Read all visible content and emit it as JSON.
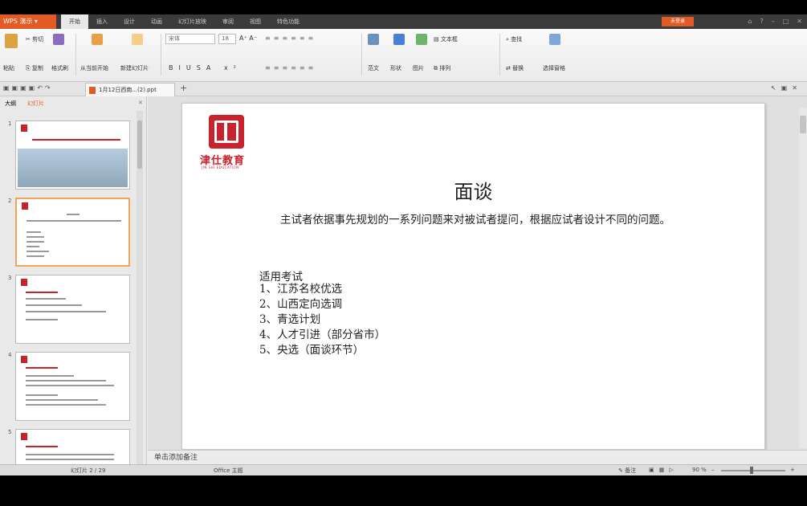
{
  "app": {
    "name": "WPS 演示"
  },
  "menu": [
    "开始",
    "插入",
    "设计",
    "动画",
    "幻灯片放映",
    "审阅",
    "视图",
    "特色功能"
  ],
  "login_label": "未登录",
  "ribbon": {
    "paste": "粘贴",
    "cut": "剪切",
    "copy": "复制",
    "format_painter": "格式刷",
    "from_start": "从当前开始",
    "new_slide": "新建幻灯片",
    "font_name": "宋体",
    "font_size": "18",
    "text_tool": "范文",
    "shape": "形状",
    "picture": "图片",
    "textbox": "文本框",
    "arrange": "排列",
    "find": "查找",
    "replace": "替换",
    "select_pane": "选择窗格"
  },
  "doc_tab": "1月12日西南...(2).ppt",
  "pane_tabs": {
    "outline": "大纲",
    "slides": "幻灯片"
  },
  "thumbs": [
    {
      "num": "1"
    },
    {
      "num": "2"
    },
    {
      "num": "3"
    },
    {
      "num": "4"
    },
    {
      "num": "5"
    }
  ],
  "slide": {
    "logo_cn": "津仕教育",
    "logo_en": "JIN SHI EDUCATION",
    "title": "面谈",
    "body": "主试者依据事先规划的一系列问题来对被试者提问，根据应试者设计不同的问题。",
    "exam_head": "适用考试",
    "exams": [
      "1、江苏名校优选",
      "2、山西定向选调",
      "3、青选计划",
      "4、人才引进（部分省市）",
      "5、央选（面谈环节）"
    ]
  },
  "notes": "单击添加备注",
  "status": {
    "slide_counter": "幻灯片 2 / 29",
    "theme": "Office 主题",
    "notes_toggle": "备注",
    "zoom": "90 %"
  },
  "colors": {
    "accent": "#e25a24",
    "logo_red": "#c8232c",
    "thumb_sel": "#f2a35c"
  }
}
